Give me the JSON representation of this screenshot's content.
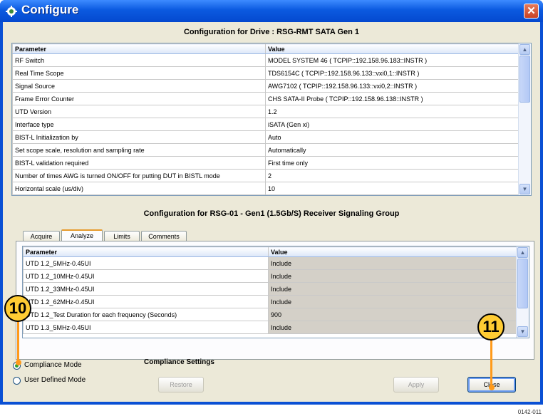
{
  "window": {
    "title": "Configure",
    "close_glyph": "✕"
  },
  "drive_heading": "Configuration for Drive : RSG-RMT SATA Gen 1",
  "drive_table": {
    "headers": [
      "Parameter",
      "Value"
    ],
    "rows": [
      [
        "RF Switch",
        "MODEL SYSTEM 46 ( TCPIP::192.158.96.183::INSTR )"
      ],
      [
        "Real Time Scope",
        "TDS6154C ( TCPIP::192.158.96.133::vxi0,1::INSTR )"
      ],
      [
        "Signal Source",
        "AWG7102 ( TCPIP::192.158.96.133::vxi0,2::INSTR )"
      ],
      [
        "Frame Error Counter",
        "CHS SATA-II Probe ( TCPIP::192.158.96.138::INSTR )"
      ],
      [
        "UTD Version",
        "1.2"
      ],
      [
        "Interface type",
        "iSATA (Gen xi)"
      ],
      [
        "BIST-L Initialization by",
        "Auto"
      ],
      [
        "Set scope scale, resolution and sampling rate",
        "Automatically"
      ],
      [
        "BIST-L validation required",
        "First time only"
      ],
      [
        "Number of times AWG is turned ON/OFF for putting DUT in BISTL mode",
        "2"
      ],
      [
        "Horizontal scale (us/div)",
        "10"
      ]
    ]
  },
  "group_heading": "Configuration for RSG-01 - Gen1 (1.5Gb/S) Receiver Signaling Group",
  "tabs": [
    "Acquire",
    "Analyze",
    "Limits",
    "Comments"
  ],
  "group_table": {
    "headers": [
      "Parameter",
      "Value"
    ],
    "rows": [
      [
        "UTD 1.2_5MHz-0.45UI",
        "Include"
      ],
      [
        "UTD 1.2_10MHz-0.45UI",
        "Include"
      ],
      [
        "UTD 1.2_33MHz-0.45UI",
        "Include"
      ],
      [
        "UTD 1.2_62MHz-0.45UI",
        "Include"
      ],
      [
        "UTD 1.2_Test Duration for each frequency (Seconds)",
        "900"
      ],
      [
        "UTD 1.3_5MHz-0.45UI",
        "Include"
      ]
    ]
  },
  "modes": {
    "compliance": "Compliance Mode",
    "user_defined": "User Defined Mode"
  },
  "compliance_settings": "Compliance Settings",
  "buttons": {
    "restore": "Restore",
    "apply": "Apply",
    "close": "Close"
  },
  "callouts": {
    "left": "10",
    "right": "11"
  },
  "figure_id": "0142-011",
  "colors": {
    "callout_fill": "#ffcc33",
    "leader": "#ff9a1a",
    "titlebar": "#0b5ae0"
  }
}
